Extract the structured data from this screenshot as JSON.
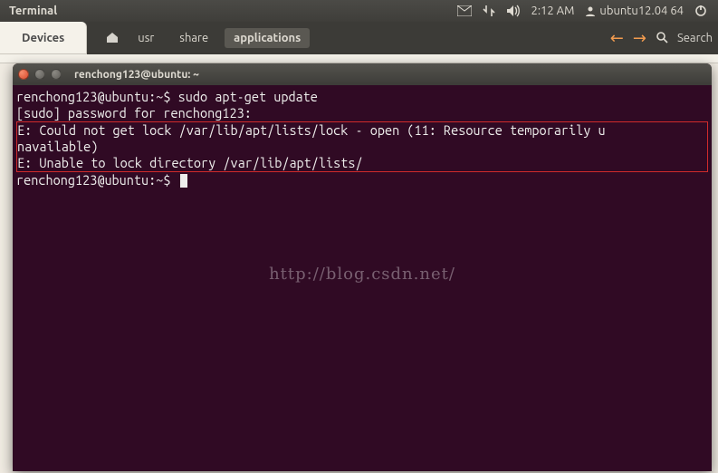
{
  "top_panel": {
    "app_name": "Terminal",
    "time": "2:12 AM",
    "user": "ubuntu12.04 64"
  },
  "mid_bar": {
    "devices_label": "Devices",
    "crumbs": {
      "usr": "usr",
      "share": "share",
      "applications": "applications"
    },
    "search_label": "Search"
  },
  "terminal": {
    "title": "renchong123@ubuntu: ~",
    "line1": "renchong123@ubuntu:~$ sudo apt-get update",
    "line2": "[sudo] password for renchong123:",
    "err1": "E: Could not get lock /var/lib/apt/lists/lock - open (11: Resource temporarily u",
    "err2": "navailable)",
    "err3": "E: Unable to lock directory /var/lib/apt/lists/",
    "line3": "renchong123@ubuntu:~$ ",
    "watermark": "http://blog.csdn.net/"
  }
}
